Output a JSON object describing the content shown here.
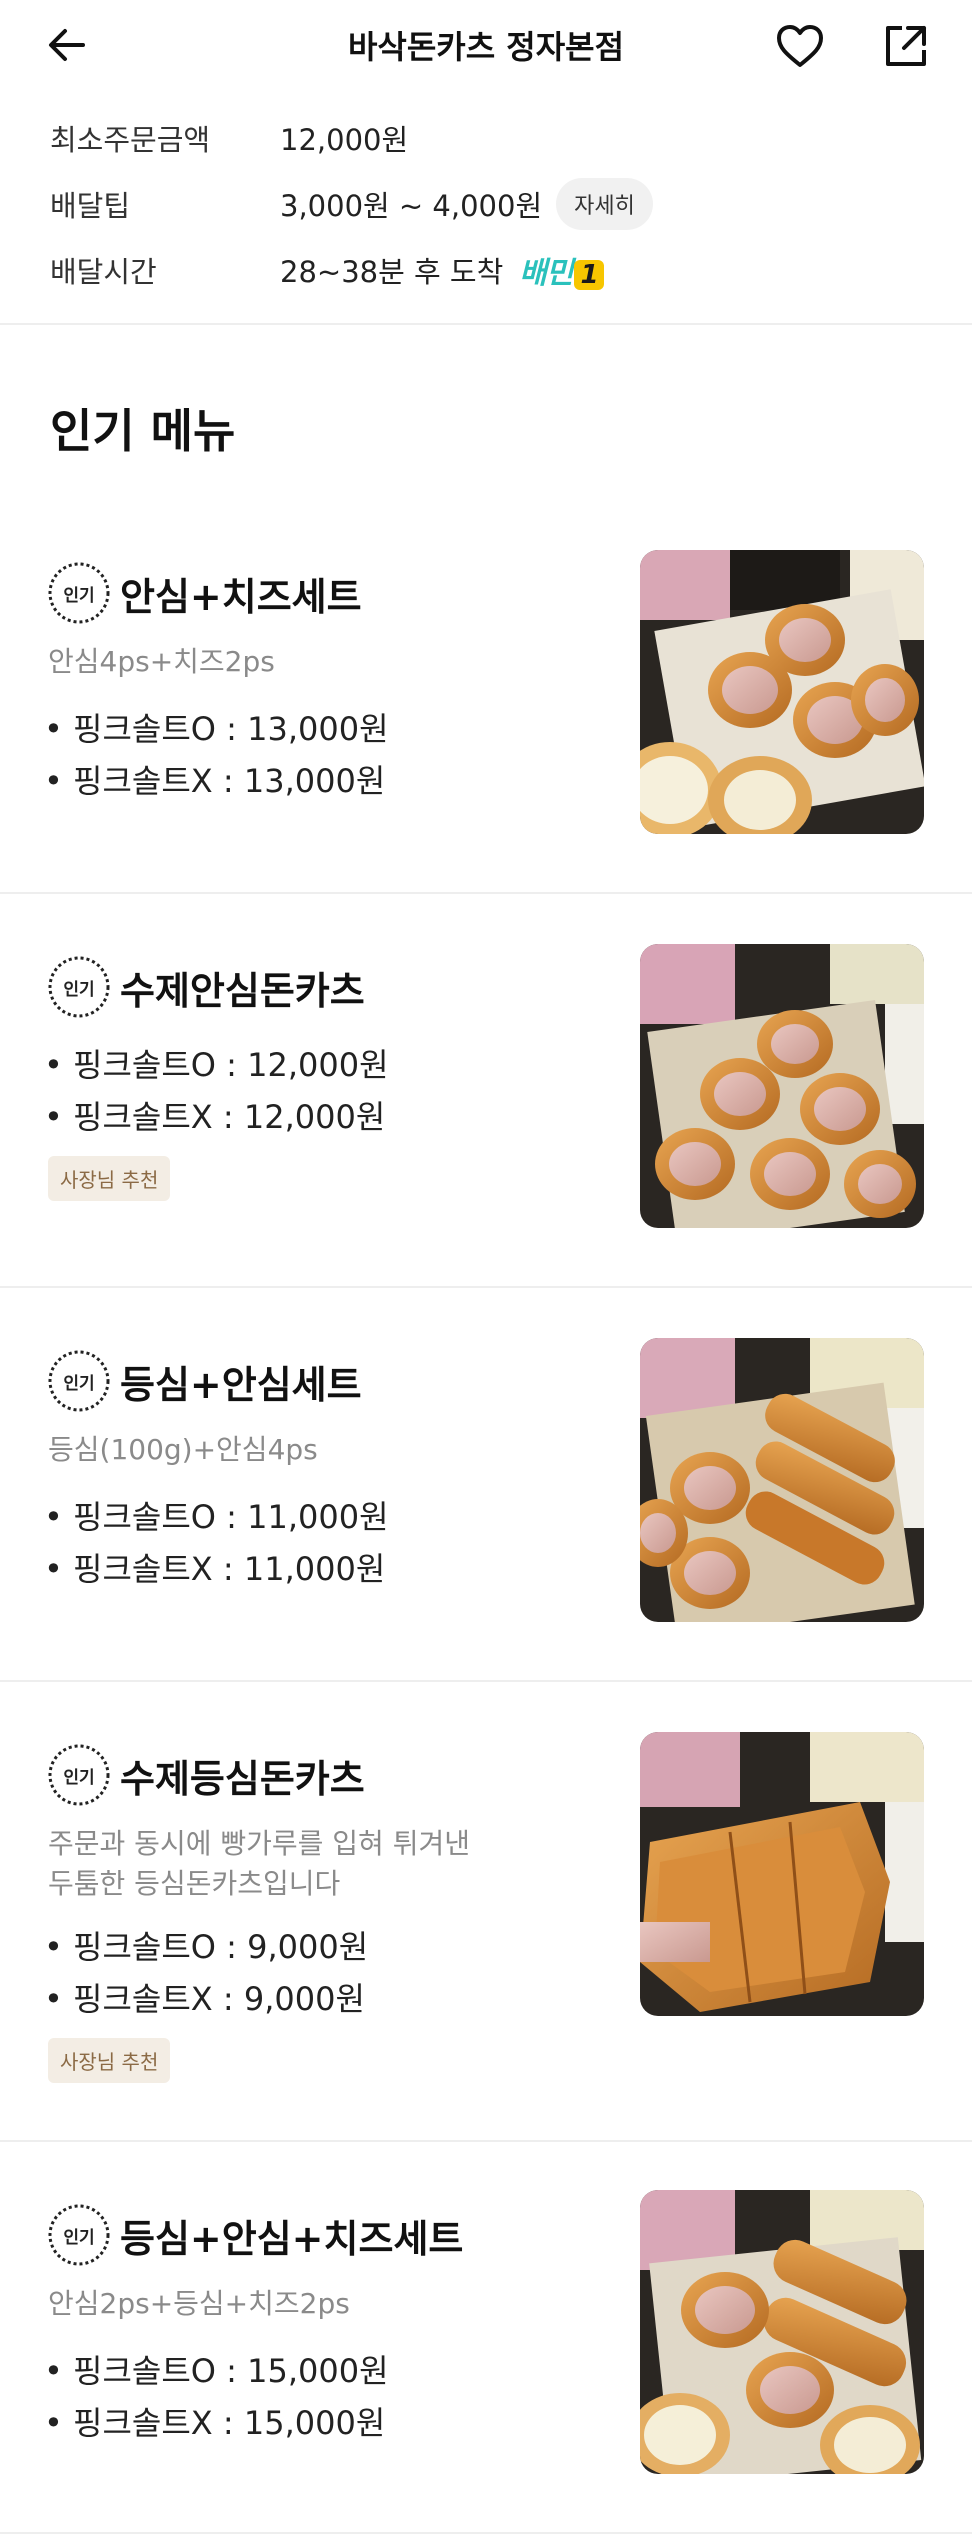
{
  "header": {
    "title": "바삭돈카츠 정자본점"
  },
  "info": {
    "min_order_label": "최소주문금액",
    "min_order_value": "12,000원",
    "delivery_tip_label": "배달팁",
    "delivery_tip_value": "3,000원 ~ 4,000원",
    "detail_chip": "자세히",
    "delivery_time_label": "배달시간",
    "delivery_time_value": "28~38분 후 도착",
    "badge_text": "배민",
    "badge_num": "1"
  },
  "section": {
    "title": "인기 메뉴"
  },
  "popular_badge_text": "인기",
  "menus": [
    {
      "name": "안심+치즈세트",
      "desc": "안심4ps+치즈2ps",
      "price_o": "• 핑크솔트O : 13,000원",
      "price_x": "• 핑크솔트X : 13,000원",
      "tag": ""
    },
    {
      "name": "수제안심돈카츠",
      "desc": "",
      "price_o": "• 핑크솔트O : 12,000원",
      "price_x": "• 핑크솔트X : 12,000원",
      "tag": "사장님 추천"
    },
    {
      "name": "등심+안심세트",
      "desc": "등심(100g)+안심4ps",
      "price_o": "• 핑크솔트O : 11,000원",
      "price_x": "• 핑크솔트X : 11,000원",
      "tag": ""
    },
    {
      "name": "수제등심돈카츠",
      "desc_line1": "주문과 동시에 빵가루를 입혀 튀겨낸",
      "desc_line2": "두툼한 등심돈카츠입니다",
      "price_o": "• 핑크솔트O : 9,000원",
      "price_x": "• 핑크솔트X : 9,000원",
      "tag": "사장님 추천"
    },
    {
      "name": "등심+안심+치즈세트",
      "desc": "안심2ps+등심+치즈2ps",
      "price_o": "• 핑크솔트O : 15,000원",
      "price_x": "• 핑크솔트X : 15,000원",
      "tag": ""
    }
  ],
  "colors": {
    "accent_mint": "#2ac1bc",
    "tag_bg": "#f3ede4",
    "tag_text": "#8b6a45"
  }
}
